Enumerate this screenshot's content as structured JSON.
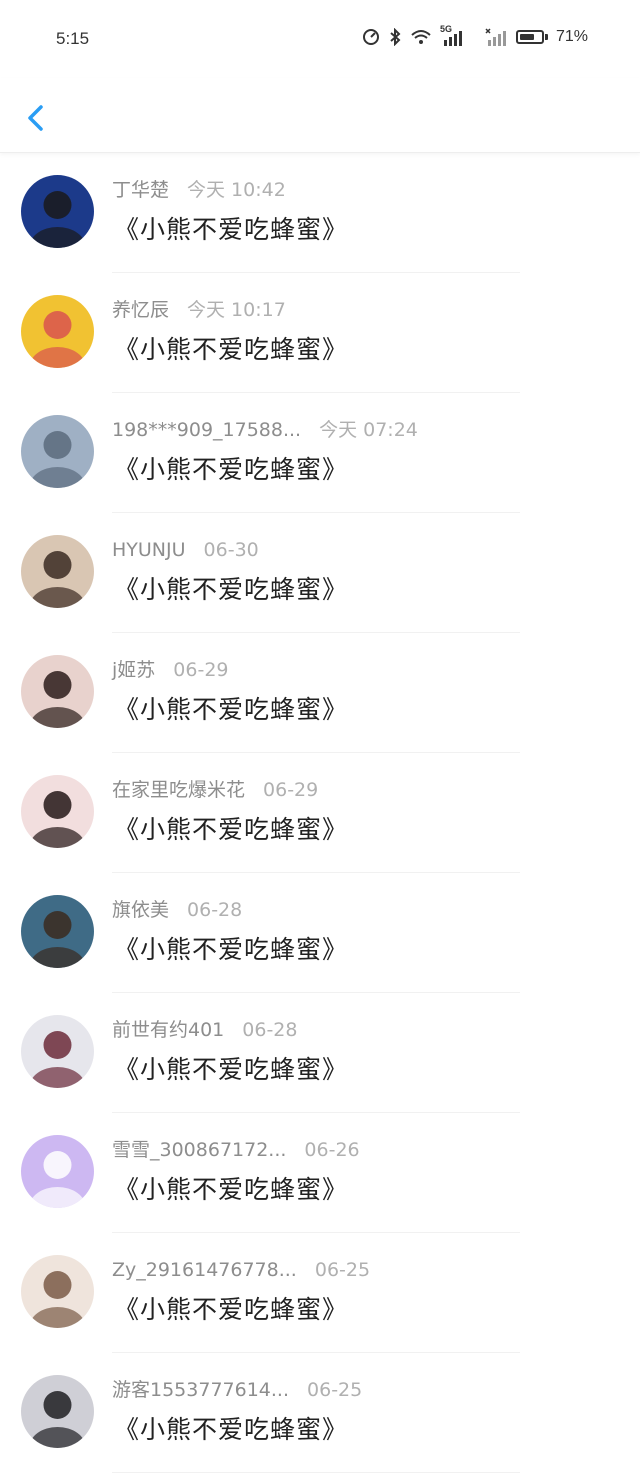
{
  "status_bar": {
    "time": "5:15",
    "network": "5G",
    "battery_percent": "71%",
    "battery_level": 0.71
  },
  "nav": {
    "back_icon": "chevron-left-icon",
    "accent_color": "#2a9df4"
  },
  "items": [
    {
      "name": "丁华楚",
      "time": "今天 10:42",
      "message": "《小熊不爱吃蜂蜜》",
      "avatar_color": "#1c3a8a",
      "avatar_accent": "#1a1a1a"
    },
    {
      "name": "养忆辰",
      "time": "今天 10:17",
      "message": "《小熊不爱吃蜂蜜》",
      "avatar_color": "#f1c232",
      "avatar_accent": "#d9534f"
    },
    {
      "name": "198***909_17588...",
      "time": "今天 07:24",
      "message": "《小熊不爱吃蜂蜜》",
      "avatar_color": "#9fb0c4",
      "avatar_accent": "#5b6b7d"
    },
    {
      "name": "HYUNJU",
      "time": "06-30",
      "message": "《小熊不爱吃蜂蜜》",
      "avatar_color": "#d9c6b3",
      "avatar_accent": "#3a2a22"
    },
    {
      "name": "j姬苏",
      "time": "06-29",
      "message": "《小熊不爱吃蜂蜜》",
      "avatar_color": "#e8d2cd",
      "avatar_accent": "#2b1c1a"
    },
    {
      "name": "在家里吃爆米花",
      "time": "06-29",
      "message": "《小熊不爱吃蜂蜜》",
      "avatar_color": "#f2dede",
      "avatar_accent": "#241717"
    },
    {
      "name": "旗依美",
      "time": "06-28",
      "message": "《小熊不爱吃蜂蜜》",
      "avatar_color": "#3f6b86",
      "avatar_accent": "#3b2a1f"
    },
    {
      "name": "前世有约401",
      "time": "06-28",
      "message": "《小熊不爱吃蜂蜜》",
      "avatar_color": "#e6e6ec",
      "avatar_accent": "#6b2a3a"
    },
    {
      "name": "雪雪_300867172...",
      "time": "06-26",
      "message": "《小熊不爱吃蜂蜜》",
      "avatar_color": "#cdb8f2",
      "avatar_accent": "#ffffff"
    },
    {
      "name": "Zy_29161476778...",
      "time": "06-25",
      "message": "《小熊不爱吃蜂蜜》",
      "avatar_color": "#efe4dc",
      "avatar_accent": "#7a5b46"
    },
    {
      "name": "游客1553777614...",
      "time": "06-25",
      "message": "《小熊不爱吃蜂蜜》",
      "avatar_color": "#cfcfd6",
      "avatar_accent": "#1e1e22"
    }
  ]
}
